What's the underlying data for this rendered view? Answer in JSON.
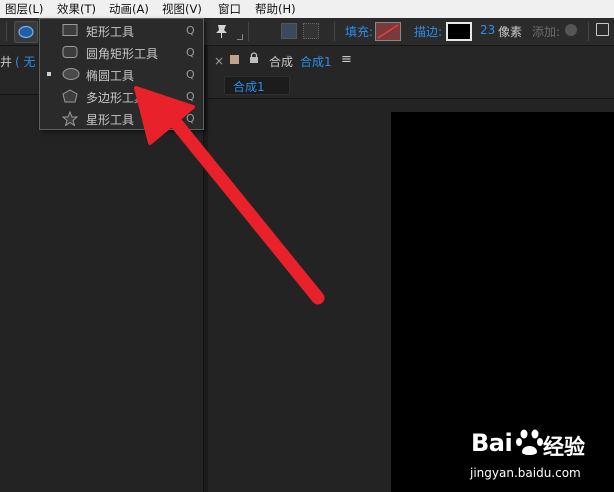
{
  "menubar": {
    "items": [
      "图层(L)",
      "效果(T)",
      "动画(A)",
      "视图(V)",
      "窗口",
      "帮助(H)"
    ]
  },
  "toolbar": {
    "fill_label": "填充:",
    "stroke_label": "描边:",
    "stroke_width": "23",
    "stroke_unit": "像素",
    "add_label": "添加:"
  },
  "shape_menu": {
    "items": [
      {
        "label": "矩形工具",
        "key": "Q",
        "icon": "rectangle-icon",
        "selected": false
      },
      {
        "label": "圆角矩形工具",
        "key": "Q",
        "icon": "rounded-rectangle-icon",
        "selected": false
      },
      {
        "label": "椭圆工具",
        "key": "Q",
        "icon": "ellipse-icon",
        "selected": true
      },
      {
        "label": "多边形工具",
        "key": "Q",
        "icon": "polygon-icon",
        "selected": false
      },
      {
        "label": "星形工具",
        "key": "Q",
        "icon": "star-icon",
        "selected": false
      }
    ]
  },
  "left_panel": {
    "label_prefix": "井",
    "label_value": "( 无"
  },
  "composition_panel": {
    "title_prefix": "合成",
    "title_name": "合成1",
    "tab": "合成1"
  },
  "watermark": {
    "brand": "Bai",
    "brand_cn": "经验",
    "url": "jingyan.baidu.com"
  },
  "colors": {
    "accent_blue": "#2d8ceb",
    "arrow_red": "#e8212b",
    "fill_swatch": "#c84a4a"
  }
}
